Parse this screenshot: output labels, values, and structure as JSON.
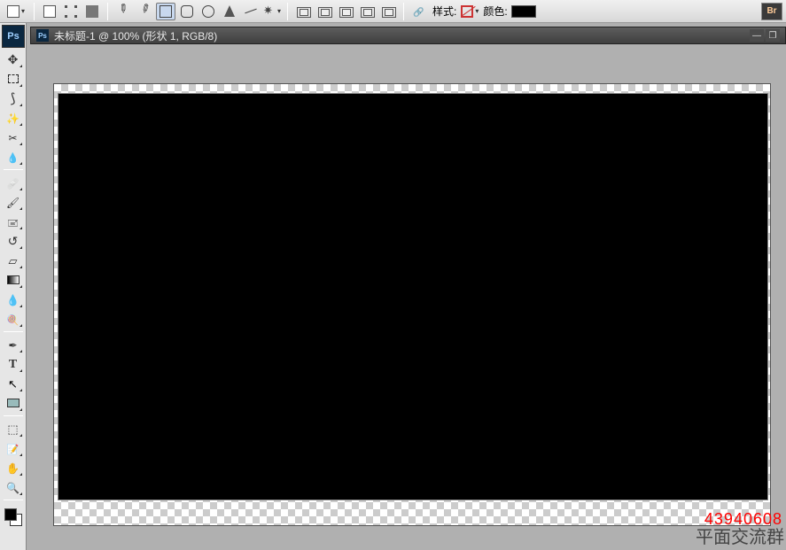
{
  "optionsbar": {
    "style_label": "样式:",
    "color_label": "颜色:",
    "color_value": "#000000",
    "br_label": "Br"
  },
  "document": {
    "title_prefix": "未标题-1 @ 100% (形状 1, RGB/8)",
    "ps_badge": "Ps"
  },
  "watermark": {
    "number": "43940608",
    "group": "平面交流群"
  },
  "tool_icons": {
    "move": "move",
    "marquee": "marquee",
    "lasso": "lasso",
    "wand": "wand",
    "crop": "crop",
    "eyedrop": "eyedropper",
    "heal": "heal",
    "brush": "brush",
    "stamp": "clone-stamp",
    "history": "history-brush",
    "eraser": "eraser",
    "gradient": "gradient",
    "blur": "blur",
    "dodge": "dodge",
    "pen": "pen",
    "type": "type",
    "path": "path-select",
    "shape": "shape",
    "threeD": "3d",
    "hand": "hand",
    "zoom": "zoom",
    "notes": "notes"
  }
}
